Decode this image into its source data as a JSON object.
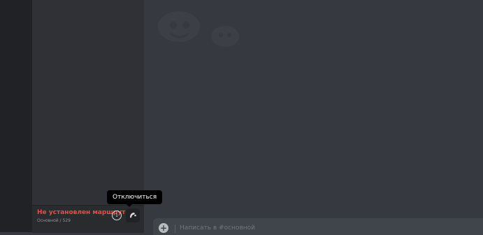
{
  "voice_panel": {
    "status_text": "Не установлен маршрут",
    "channel_info": "Основной / 529",
    "info_icon": "info-icon",
    "disconnect_icon": "phone-hangup-icon",
    "status_color": "#f04747"
  },
  "tooltip": {
    "text": "Отключиться"
  },
  "composer": {
    "placeholder": "Написать в #основной",
    "add_icon": "plus-circle-icon"
  }
}
